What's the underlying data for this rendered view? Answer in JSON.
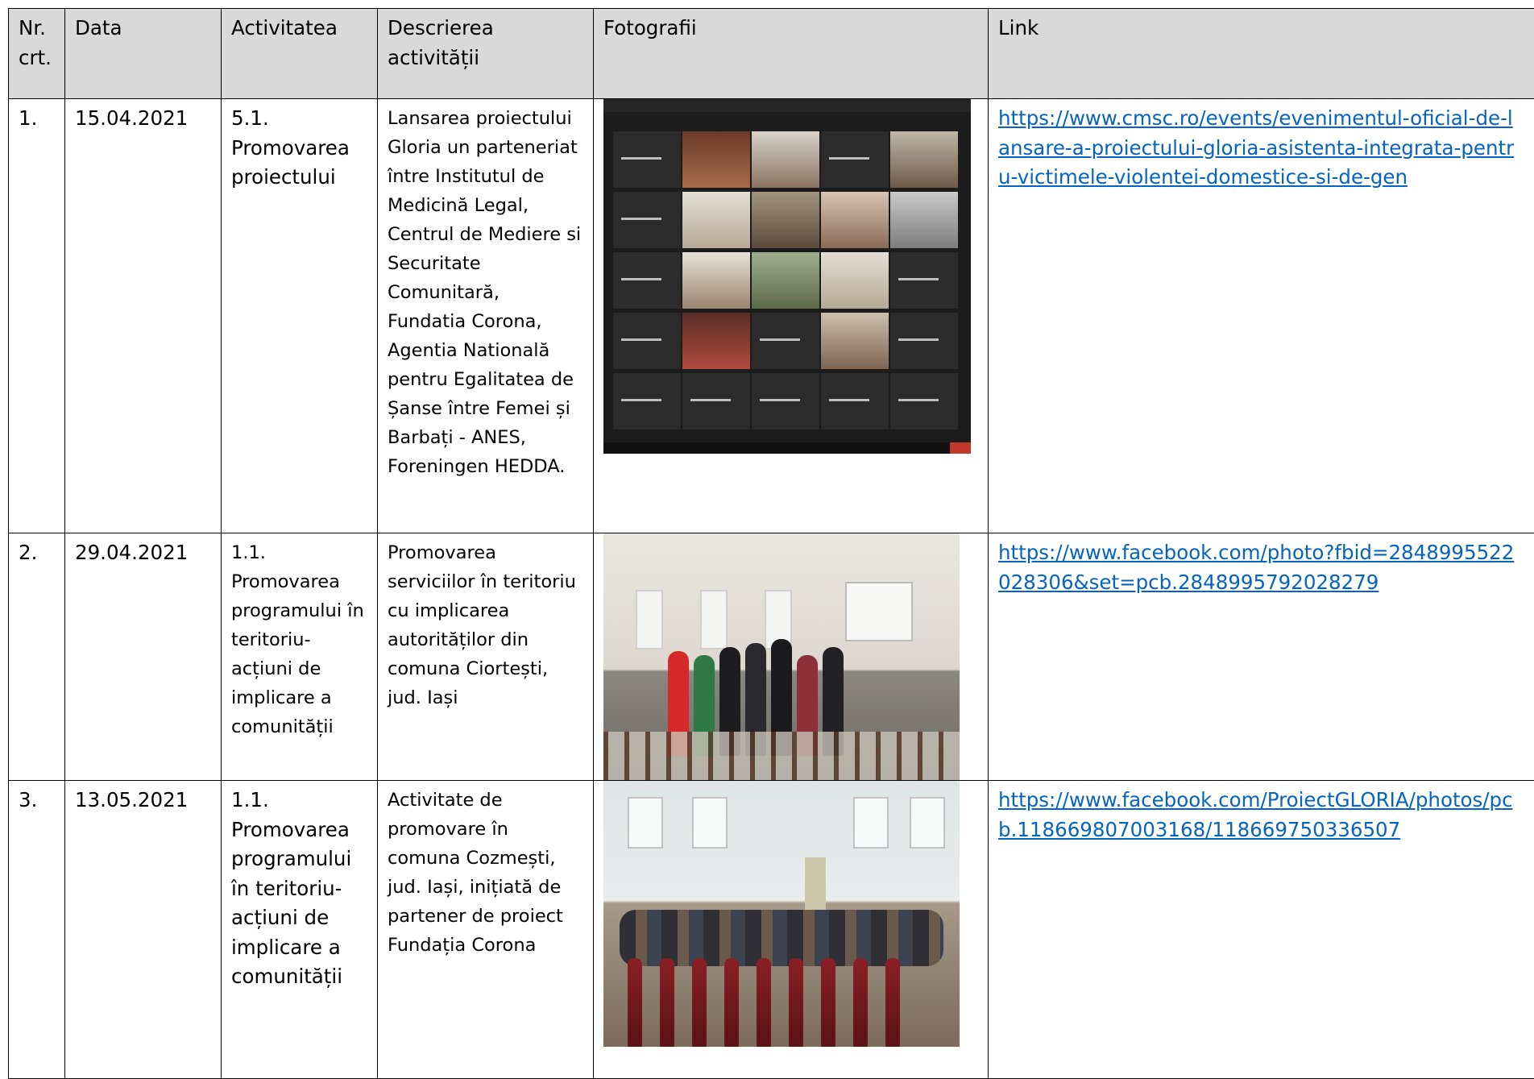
{
  "headers": {
    "nr": "Nr. crt.",
    "data": "Data",
    "activitatea": "Activitatea",
    "descrierea": "Descrierea activității",
    "fotografii": "Fotografii",
    "link": "Link"
  },
  "rows": [
    {
      "nr": "1.",
      "data": "15.04.2021",
      "activitatea": "5.1. Promovarea proiectului",
      "descrierea": "Lansarea proiectului Gloria un parteneriat între Institutul de Medicină Legal, Centrul de Mediere si Securitate Comunitară, Fundatia Corona, Agentia Natională pentru Egalitatea de Șanse între Femei și Barbați - ANES, Foreningen HEDDA.",
      "link": "https://www.cmsc.ro/events/evenimentul-oficial-de-lansare-a-proiectului-gloria-asistenta-integrata-pentru-victimele-violentei-domestice-si-de-gen"
    },
    {
      "nr": "2.",
      "data": "29.04.2021",
      "activitatea": "1.1. Promovarea programului în teritoriu- acțiuni de implicare a comunității",
      "descrierea": "Promovarea serviciilor în teritoriu cu implicarea autorităților din comuna Ciortești, jud. Iași",
      "link": "https://www.facebook.com/photo?fbid=2848995522028306&set=pcb.2848995792028279"
    },
    {
      "nr": "3.",
      "data": "13.05.2021",
      "activitatea": "1.1. Promovarea programului în teritoriu- acțiuni de implicare a comunității",
      "descrierea": "Activitate de promovare în comuna Cozmești, jud. Iași, inițiată de partener de proiect Fundația Corona",
      "link": "https://www.facebook.com/ProiectGLORIA/photos/pcb.118669807003168/118669750336507"
    }
  ]
}
